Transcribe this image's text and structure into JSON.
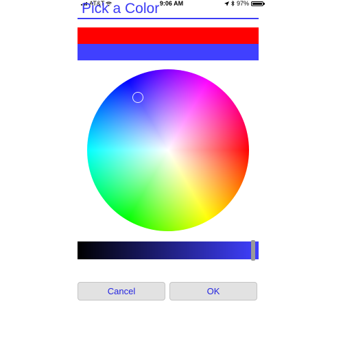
{
  "status_bar": {
    "carrier": "AT&T",
    "time": "9:06 AM",
    "battery_percent": "97%",
    "battery_level": 0.97,
    "icons": [
      "signal-icon",
      "wifi-icon",
      "location-arrow-icon",
      "bluetooth-icon",
      "battery-icon"
    ]
  },
  "dialog": {
    "title": "Pick a Color",
    "accent_color": "#3b3bf5",
    "original_color": "#ff0000",
    "selected_color": "#4040ff",
    "wheel_selection": {
      "hue_degrees": 240,
      "saturation": 0.75
    },
    "brightness": 0.97,
    "buttons": {
      "cancel_label": "Cancel",
      "ok_label": "OK"
    }
  }
}
